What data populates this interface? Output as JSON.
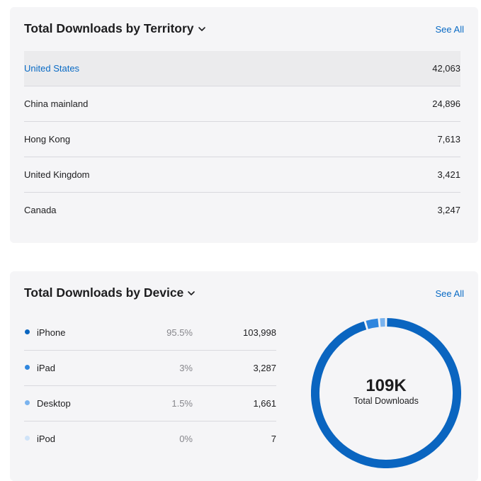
{
  "territory": {
    "title": "Total Downloads by Territory",
    "see_all": "See All",
    "rows": [
      {
        "name": "United States",
        "value": "42,063"
      },
      {
        "name": "China mainland",
        "value": "24,896"
      },
      {
        "name": "Hong Kong",
        "value": "7,613"
      },
      {
        "name": "United Kingdom",
        "value": "3,421"
      },
      {
        "name": "Canada",
        "value": "3,247"
      }
    ]
  },
  "device": {
    "title": "Total Downloads by Device",
    "see_all": "See All",
    "rows": [
      {
        "name": "iPhone",
        "pct": "95.5%",
        "value": "103,998",
        "color": "#0a65c0"
      },
      {
        "name": "iPad",
        "pct": "3%",
        "value": "3,287",
        "color": "#2f86de"
      },
      {
        "name": "Desktop",
        "pct": "1.5%",
        "value": "1,661",
        "color": "#7ab3ee"
      },
      {
        "name": "iPod",
        "pct": "0%",
        "value": "7",
        "color": "#cfe3f8"
      }
    ],
    "donut": {
      "total": "109K",
      "label": "Total Downloads"
    }
  },
  "colors": {
    "accent": "#0a6bc5",
    "card_bg": "#f5f5f7",
    "selected_row": "#ebebed"
  },
  "icons": {
    "title_dropdown": "chevron-down-icon",
    "legend_marker": "dot-icon"
  }
}
